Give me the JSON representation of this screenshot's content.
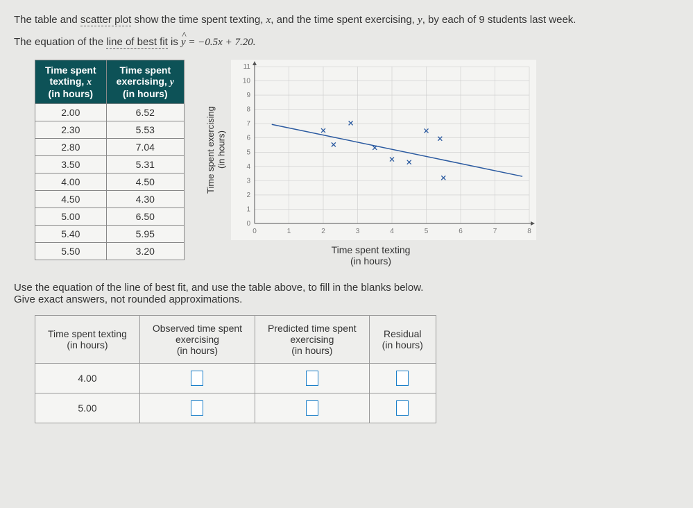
{
  "intro": {
    "part1": "The table and ",
    "link1": "scatter plot",
    "part2": " show the time spent texting, ",
    "var1": "x",
    "part3": ", and the time spent exercising, ",
    "var2": "y",
    "part4": ", by each of 9 students last week."
  },
  "eq": {
    "part1": "The equation of the ",
    "link": "line of best fit",
    "part2": " is ",
    "lhs": "y",
    "rhs": " = −0.5x + 7.20."
  },
  "table": {
    "head1a": "Time spent",
    "head1b": "texting, ",
    "head1var": "x",
    "head1c": "(in hours)",
    "head2a": "Time spent",
    "head2b": "exercising, ",
    "head2var": "y",
    "head2c": "(in hours)",
    "rows": [
      {
        "x": "2.00",
        "y": "6.52"
      },
      {
        "x": "2.30",
        "y": "5.53"
      },
      {
        "x": "2.80",
        "y": "7.04"
      },
      {
        "x": "3.50",
        "y": "5.31"
      },
      {
        "x": "4.00",
        "y": "4.50"
      },
      {
        "x": "4.50",
        "y": "4.30"
      },
      {
        "x": "5.00",
        "y": "6.50"
      },
      {
        "x": "5.40",
        "y": "5.95"
      },
      {
        "x": "5.50",
        "y": "3.20"
      }
    ]
  },
  "chart_data": {
    "type": "scatter",
    "title": "",
    "xlabel": "Time spent texting\n(in hours)",
    "ylabel": "Time spent exercising\n(in hours)",
    "xlim": [
      0,
      8
    ],
    "ylim": [
      0,
      11
    ],
    "xticks": [
      0,
      1,
      2,
      3,
      4,
      5,
      6,
      7,
      8
    ],
    "yticks": [
      0,
      1,
      2,
      3,
      4,
      5,
      6,
      7,
      8,
      9,
      10,
      11
    ],
    "series": [
      {
        "name": "students",
        "x": [
          2.0,
          2.3,
          2.8,
          3.5,
          4.0,
          4.5,
          5.0,
          5.4,
          5.5
        ],
        "y": [
          6.52,
          5.53,
          7.04,
          5.31,
          4.5,
          4.3,
          6.5,
          5.95,
          3.2
        ]
      }
    ],
    "fit_line": {
      "slope": -0.5,
      "intercept": 7.2
    }
  },
  "instruct": {
    "line1": "Use the equation of the line of best fit, and use the table above, to fill in the blanks below.",
    "line2": "Give exact answers, not rounded approximations."
  },
  "blank_table": {
    "h1a": "Time spent texting",
    "h1b": "(in hours)",
    "h2a": "Observed time spent",
    "h2b": "exercising",
    "h2c": "(in hours)",
    "h3a": "Predicted time spent",
    "h3b": "exercising",
    "h3c": "(in hours)",
    "h4a": "Residual",
    "h4b": "(in hours)",
    "r1": "4.00",
    "r2": "5.00"
  }
}
